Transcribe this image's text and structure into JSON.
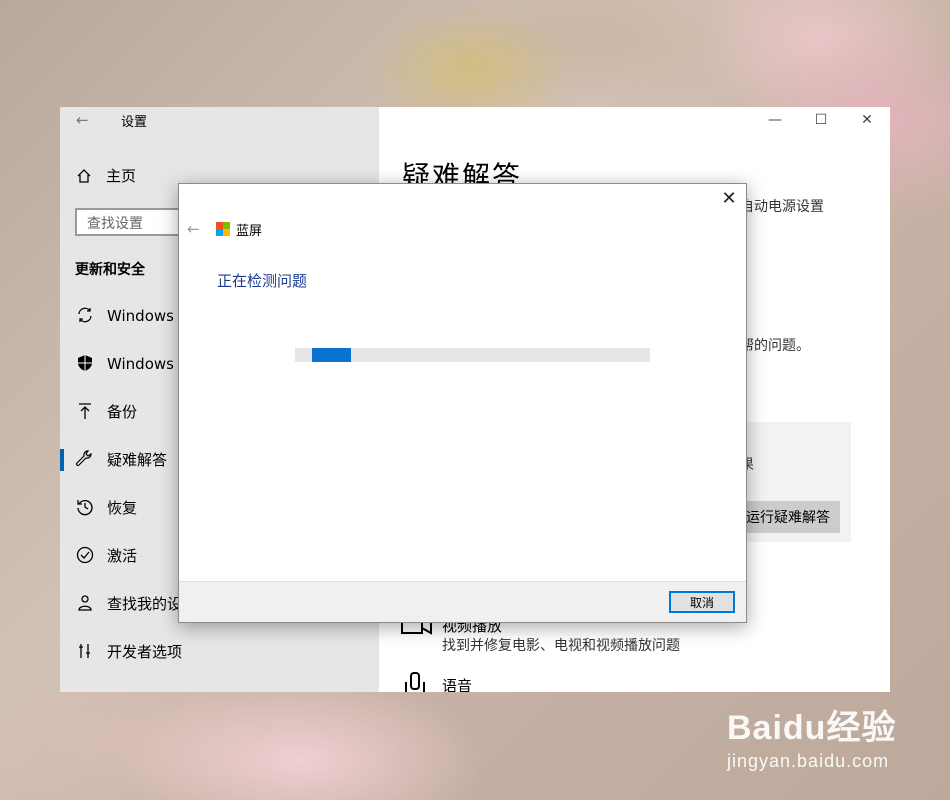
{
  "settings": {
    "app_title": "设置",
    "back_glyph": "←",
    "home_label": "主页",
    "search_placeholder": "查找设置",
    "section_title": "更新和安全",
    "nav": [
      {
        "label": "Windows 更",
        "icon": "sync-icon"
      },
      {
        "label": "Windows 安",
        "icon": "shield-icon"
      },
      {
        "label": "备份",
        "icon": "upload-arrow-icon"
      },
      {
        "label": "疑难解答",
        "icon": "wrench-icon",
        "active": true
      },
      {
        "label": "恢复",
        "icon": "history-icon"
      },
      {
        "label": "激活",
        "icon": "check-circle-icon"
      },
      {
        "label": "查找我的设",
        "icon": "person-location-icon"
      },
      {
        "label": "开发者选项",
        "icon": "tools-icon"
      }
    ],
    "window_controls": {
      "minimize": "—",
      "maximize": "☐",
      "close": "✕"
    },
    "main": {
      "title": "疑难解答",
      "text_top": "自动电源设置",
      "text_mid": "帮的问题。",
      "card_text": "果",
      "run_button": "运行疑难解答",
      "video_title": "视频播放",
      "video_desc": "找到并修复电影、电视和视频播放问题",
      "speech_title": "语音"
    }
  },
  "dialog": {
    "close_glyph": "✕",
    "back_glyph": "←",
    "app_title": "蓝屏",
    "heading": "正在检测问题",
    "progress_fraction": 0.11,
    "cancel_label": "取消"
  },
  "watermark": {
    "logo": "Baidu经验",
    "url": "jingyan.baidu.com"
  },
  "colors": {
    "accent": "#0063b1",
    "progress": "#0a72cf",
    "heading": "#1e3c8c"
  }
}
